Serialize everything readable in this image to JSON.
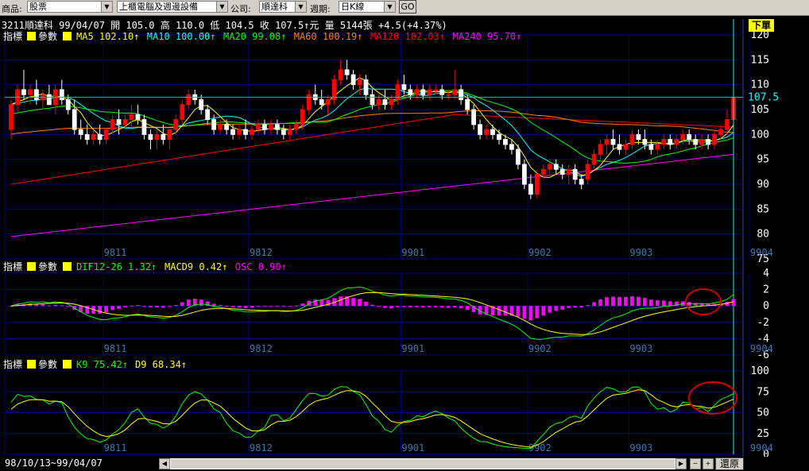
{
  "toolbar": {
    "product_label": "商品:",
    "product_value": "股票",
    "category_value": "上櫃電腦及週邊設備",
    "company_label": "公司:",
    "company_value": "順達科",
    "period_label": "週期:",
    "period_value": "日K線",
    "go_label": "GO"
  },
  "quote": {
    "stock": "3211順達科",
    "date": "99/04/07",
    "open_label": "開",
    "open": "105.0",
    "high_label": "高",
    "high": "110.0",
    "low_label": "低",
    "low": "104.5",
    "close_label": "收",
    "close": "107.5",
    "unit": "元",
    "volume_label": "量",
    "volume": "5144張",
    "change": "+4.5(+4.37%)"
  },
  "order_button": "下單",
  "panel_prefix": {
    "indicator": "指標",
    "param": "參數"
  },
  "ma_legend": [
    {
      "text": "MA5 102.10",
      "color": "#ffff00"
    },
    {
      "text": "MA10 100.00",
      "color": "#00ffff"
    },
    {
      "text": "MA20 99.08",
      "color": "#00ff00"
    },
    {
      "text": "MA60 100.19",
      "color": "#ff8000"
    },
    {
      "text": "MA120 102.03",
      "color": "#ff0000"
    },
    {
      "text": "MA240 95.70",
      "color": "#ff00ff"
    }
  ],
  "macd_legend": [
    {
      "text": "DIF12-26 1.32",
      "color": "#00ff00"
    },
    {
      "text": "MACD9 0.42",
      "color": "#ffff00"
    },
    {
      "text": "OSC 0.90",
      "color": "#ff00ff"
    }
  ],
  "kd_legend": [
    {
      "text": "K9 75.42",
      "color": "#00ff00"
    },
    {
      "text": "D9 68.34",
      "color": "#ffff00"
    }
  ],
  "price_axis": [
    "120",
    "115",
    "110",
    "105",
    "100",
    "95",
    "90",
    "85",
    "80",
    "75"
  ],
  "current_price_label": "107.5",
  "macd_axis": [
    "4",
    "2",
    "0",
    "-2",
    "-4",
    "-6"
  ],
  "kd_axis": [
    "100",
    "75",
    "50",
    "25",
    "0"
  ],
  "months": [
    "9811",
    "9812",
    "9901",
    "9902",
    "9903",
    "9904"
  ],
  "date_range": "98/10/13~99/04/07",
  "restore_label": "還原",
  "colors": {
    "up": "#ff0000",
    "down": "#ffffff",
    "grid": "#000080",
    "axis_text": "#ffffff",
    "month_text": "#3c78b4",
    "quote_text": "#ffffff",
    "annotation": "#d00000"
  },
  "chart_data": {
    "type": "candlestick",
    "dates_range": "98/10/13~99/04/07",
    "price_ylim": [
      75,
      120
    ],
    "macd_ylim": [
      -6,
      4
    ],
    "kd_ylim": [
      0,
      100
    ],
    "candles": [
      [
        101,
        107,
        99,
        106
      ],
      [
        106,
        110,
        104,
        109
      ],
      [
        109,
        113,
        107,
        108
      ],
      [
        108,
        110,
        106,
        109
      ],
      [
        109,
        111,
        106,
        107
      ],
      [
        107,
        109,
        105,
        108
      ],
      [
        108,
        110,
        106,
        106
      ],
      [
        106,
        110,
        104,
        109
      ],
      [
        109,
        111,
        106,
        107
      ],
      [
        107,
        108,
        104,
        105
      ],
      [
        105,
        107,
        100,
        101
      ],
      [
        101,
        103,
        99,
        100
      ],
      [
        100,
        102,
        98,
        99
      ],
      [
        99,
        101,
        98,
        100
      ],
      [
        100,
        102,
        98,
        99
      ],
      [
        99,
        101,
        98,
        101
      ],
      [
        101,
        104,
        100,
        103
      ],
      [
        103,
        105,
        100,
        102
      ],
      [
        102,
        104,
        101,
        103
      ],
      [
        103,
        106,
        101,
        104
      ],
      [
        104,
        106,
        102,
        103
      ],
      [
        103,
        104,
        99,
        100
      ],
      [
        100,
        101,
        97,
        99
      ],
      [
        99,
        101,
        97,
        100
      ],
      [
        100,
        102,
        98,
        99
      ],
      [
        99,
        101,
        97,
        101
      ],
      [
        101,
        104,
        100,
        103
      ],
      [
        103,
        107,
        102,
        106
      ],
      [
        106,
        109,
        105,
        108
      ],
      [
        108,
        109,
        106,
        107
      ],
      [
        107,
        108,
        104,
        105
      ],
      [
        105,
        106,
        102,
        103
      ],
      [
        103,
        104,
        100,
        101
      ],
      [
        101,
        103,
        100,
        102
      ],
      [
        102,
        103,
        100,
        101
      ],
      [
        101,
        102,
        99,
        100
      ],
      [
        100,
        102,
        99,
        101
      ],
      [
        101,
        103,
        99,
        100
      ],
      [
        100,
        102,
        99,
        101
      ],
      [
        101,
        103,
        100,
        102
      ],
      [
        102,
        103,
        100,
        101
      ],
      [
        101,
        103,
        100,
        102
      ],
      [
        102,
        103,
        100,
        101
      ],
      [
        101,
        102,
        99,
        100
      ],
      [
        100,
        102,
        99,
        101
      ],
      [
        101,
        103,
        100,
        102
      ],
      [
        102,
        106,
        101,
        105
      ],
      [
        105,
        109,
        104,
        108
      ],
      [
        108,
        110,
        106,
        107
      ],
      [
        107,
        109,
        105,
        106
      ],
      [
        106,
        108,
        104,
        107
      ],
      [
        107,
        112,
        106,
        111
      ],
      [
        111,
        115,
        110,
        113
      ],
      [
        113,
        115,
        111,
        112
      ],
      [
        112,
        113,
        109,
        110
      ],
      [
        110,
        112,
        108,
        111
      ],
      [
        111,
        112,
        107,
        108
      ],
      [
        108,
        109,
        105,
        106
      ],
      [
        106,
        108,
        105,
        107
      ],
      [
        107,
        109,
        105,
        106
      ],
      [
        106,
        108,
        105,
        107
      ],
      [
        107,
        111,
        106,
        110
      ],
      [
        110,
        112,
        108,
        109
      ],
      [
        109,
        110,
        107,
        108
      ],
      [
        108,
        110,
        107,
        109
      ],
      [
        109,
        110,
        107,
        108
      ],
      [
        108,
        110,
        107,
        109
      ],
      [
        109,
        110,
        108,
        109
      ],
      [
        109,
        110,
        107,
        108
      ],
      [
        108,
        109,
        107,
        108
      ],
      [
        108,
        113,
        107,
        109
      ],
      [
        109,
        110,
        106,
        107
      ],
      [
        107,
        108,
        104,
        105
      ],
      [
        105,
        106,
        101,
        102
      ],
      [
        102,
        103,
        99,
        100
      ],
      [
        100,
        102,
        99,
        101
      ],
      [
        101,
        102,
        99,
        100
      ],
      [
        100,
        101,
        98,
        99
      ],
      [
        99,
        100,
        97,
        98
      ],
      [
        98,
        99,
        96,
        97
      ],
      [
        97,
        98,
        93,
        94
      ],
      [
        94,
        95,
        89,
        90
      ],
      [
        90,
        92,
        87,
        88
      ],
      [
        88,
        93,
        87,
        92
      ],
      [
        92,
        94,
        91,
        93
      ],
      [
        93,
        95,
        92,
        94
      ],
      [
        94,
        95,
        92,
        93
      ],
      [
        93,
        94,
        91,
        92
      ],
      [
        92,
        94,
        90,
        93
      ],
      [
        93,
        94,
        90,
        91
      ],
      [
        91,
        92,
        89,
        90
      ],
      [
        91,
        95,
        90,
        94
      ],
      [
        94,
        97,
        93,
        96
      ],
      [
        96,
        99,
        95,
        98
      ],
      [
        98,
        100,
        96,
        99
      ],
      [
        99,
        101,
        97,
        98
      ],
      [
        98,
        100,
        96,
        97
      ],
      [
        97,
        99,
        96,
        98
      ],
      [
        98,
        101,
        97,
        100
      ],
      [
        100,
        101,
        98,
        99
      ],
      [
        99,
        101,
        97,
        98
      ],
      [
        98,
        99,
        96,
        97
      ],
      [
        97,
        99,
        96,
        98
      ],
      [
        98,
        100,
        97,
        99
      ],
      [
        99,
        100,
        97,
        98
      ],
      [
        98,
        100,
        97,
        99
      ],
      [
        99,
        101,
        98,
        100
      ],
      [
        100,
        101,
        98,
        99
      ],
      [
        99,
        100,
        97,
        98
      ],
      [
        98,
        100,
        97,
        99
      ],
      [
        99,
        100,
        97,
        98
      ],
      [
        98,
        101,
        97,
        100
      ],
      [
        100,
        102,
        99,
        101
      ],
      [
        101,
        105,
        100,
        103
      ],
      [
        103,
        110,
        102,
        107.5
      ]
    ],
    "note_candles": "rows are [open, high, low, close] in chronological order; visual estimate"
  }
}
